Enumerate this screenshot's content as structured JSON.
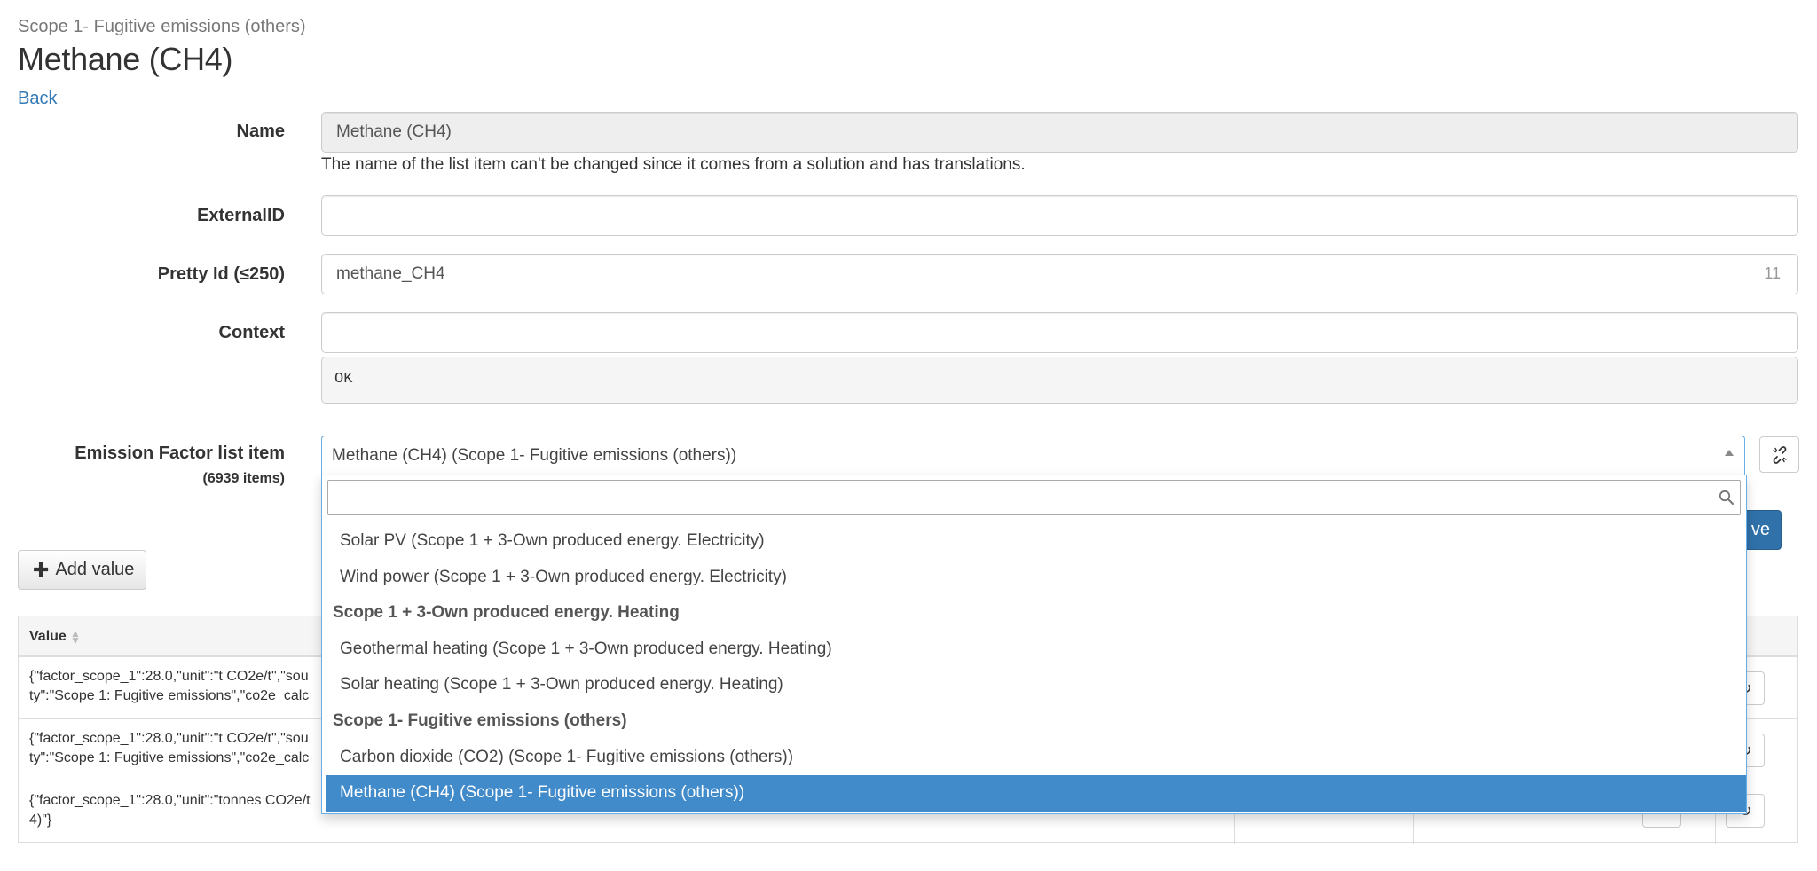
{
  "header": {
    "breadcrumb": "Scope 1- Fugitive emissions (others)",
    "title": "Methane (CH4)",
    "back_label": "Back"
  },
  "form": {
    "name_label": "Name",
    "name_value": "Methane (CH4)",
    "name_help": "The name of the list item can't be changed since it comes from a solution and has translations.",
    "external_id_label": "ExternalID",
    "external_id_value": "",
    "pretty_id_label": "Pretty Id (≤250)",
    "pretty_id_value": "methane_CH4",
    "pretty_id_count": "11",
    "context_label": "Context",
    "context_value": "",
    "context_output": "OK",
    "emission_label": "Emission Factor list item",
    "emission_count": "(6939 items)",
    "emission_selected": "Methane (CH4) (Scope 1- Fugitive emissions (others))"
  },
  "dropdown": {
    "search_value": "",
    "options": [
      {
        "label": "Solar PV (Scope 1 + 3-Own produced energy. Electricity)",
        "type": "option"
      },
      {
        "label": "Wind power (Scope 1 + 3-Own produced energy. Electricity)",
        "type": "option"
      },
      {
        "label": "Scope 1 + 3-Own produced energy. Heating",
        "type": "group"
      },
      {
        "label": "Geothermal heating (Scope 1 + 3-Own produced energy. Heating)",
        "type": "option"
      },
      {
        "label": "Solar heating (Scope 1 + 3-Own produced energy. Heating)",
        "type": "option"
      },
      {
        "label": "Scope 1- Fugitive emissions (others)",
        "type": "group"
      },
      {
        "label": "Carbon dioxide (CO2) (Scope 1- Fugitive emissions (others))",
        "type": "option"
      },
      {
        "label": "Methane (CH4) (Scope 1- Fugitive emissions (others))",
        "type": "selected"
      }
    ]
  },
  "actions": {
    "save_label": "ve",
    "add_value_label": "Add value"
  },
  "table": {
    "column_value": "Value",
    "rows": [
      {
        "line1": "{\"factor_scope_1\":28.0,\"unit\":\"t CO2e/t\",\"sou",
        "line2": "ty\":\"Scope 1: Fugitive emissions\",\"co2e_calc"
      },
      {
        "line1": "{\"factor_scope_1\":28.0,\"unit\":\"t CO2e/t\",\"sou",
        "line2": "ty\":\"Scope 1: Fugitive emissions\",\"co2e_calc"
      },
      {
        "line1": "{\"factor_scope_1\":28.0,\"unit\":\"tonnes CO2e/t",
        "line2": "4)\"}"
      }
    ]
  },
  "colors": {
    "link": "#337ab7",
    "primary": "#3071a9",
    "selected_option": "#428bca",
    "focus_border": "#66afe9"
  },
  "icons": {
    "search": "search-icon",
    "unlink": "unlink-icon",
    "plus": "plus-icon",
    "sort": "sort-icon"
  }
}
